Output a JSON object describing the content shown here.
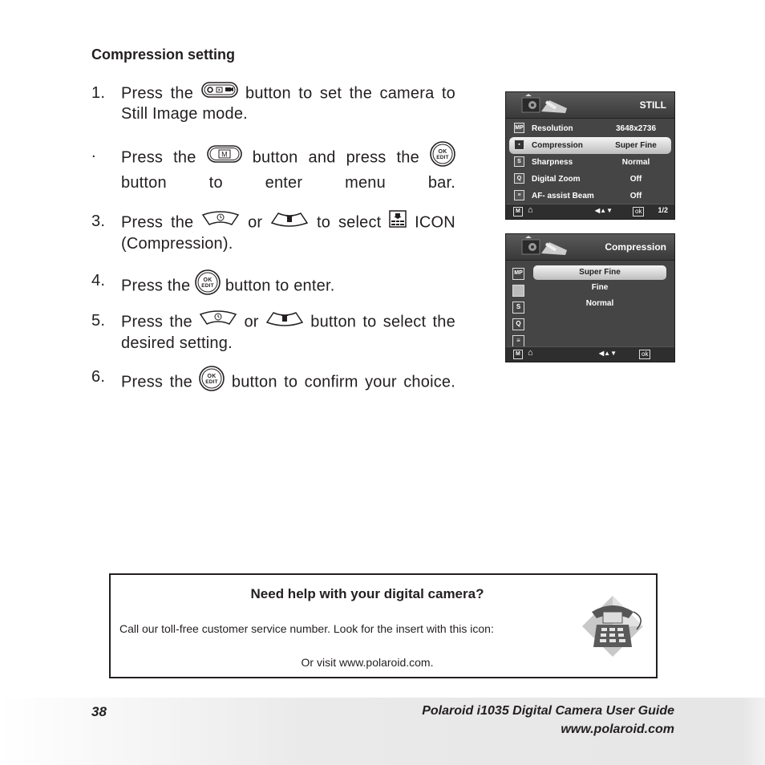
{
  "heading": "Compression setting",
  "steps": [
    {
      "num": "1.",
      "before": "Press the",
      "button": "mode-button",
      "after": "button to set the camera to Still Image mode."
    },
    {
      "num": ".",
      "before": "Press the",
      "button": "menu-button",
      "middle": "button and press the",
      "button2": "ok-edit-button",
      "after": "button to enter menu bar."
    },
    {
      "num": "3.",
      "before": "Press the",
      "button": "up-timer-button",
      "or": "or",
      "button2": "down-delete-button",
      "middle": "to select",
      "icon": "compression-icon",
      "after": "ICON (Compression)."
    },
    {
      "num": "4.",
      "before": "Press the",
      "button": "ok-edit-button",
      "after": "button to enter."
    },
    {
      "num": "5.",
      "before": "Press the",
      "button": "up-timer-button",
      "or": "or",
      "button2": "down-delete-button",
      "after": "button to select the desired setting."
    },
    {
      "num": "6.",
      "before": "Press the",
      "button": "ok-edit-button",
      "after": "button to confirm your choice."
    }
  ],
  "button_labels": {
    "menu": "M",
    "ok": "OK",
    "edit": "EDIT"
  },
  "screen1": {
    "title": "STILL",
    "rows": [
      {
        "icon": "MP",
        "label": "Resolution",
        "value": "3648x2736",
        "selected": false
      },
      {
        "icon": "compression",
        "label": "Compression",
        "value": "Super Fine",
        "selected": true
      },
      {
        "icon": "sharpness",
        "label": "Sharpness",
        "value": "Normal",
        "selected": false
      },
      {
        "icon": "digital-zoom",
        "label": "Digital Zoom",
        "value": "Off",
        "selected": false
      },
      {
        "icon": "af-beam",
        "label": "AF- assist Beam",
        "value": "Off",
        "selected": false
      }
    ],
    "footer": {
      "menu_key": "M",
      "ok": "ok",
      "page": "1/2"
    }
  },
  "screen2": {
    "title": "Compression",
    "options": [
      {
        "label": "Super Fine",
        "selected": true
      },
      {
        "label": "Fine",
        "selected": false
      },
      {
        "label": "Normal",
        "selected": false
      }
    ],
    "footer": {
      "menu_key": "M",
      "ok": "ok"
    }
  },
  "help": {
    "title": "Need help with your digital camera?",
    "call": "Call our toll-free customer service number. Look for the insert with this icon:",
    "visit": "Or visit www.polaroid.com."
  },
  "footer": {
    "page_number": "38",
    "guide_title": "Polaroid i1035 Digital Camera User Guide",
    "url": "www.polaroid.com"
  }
}
